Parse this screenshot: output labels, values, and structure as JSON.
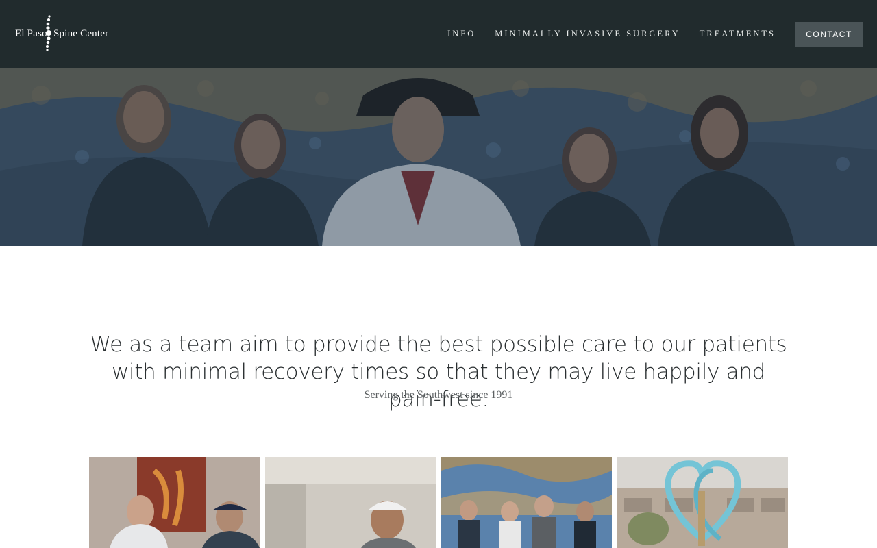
{
  "header": {
    "logo": {
      "left": "El Paso",
      "right": "Spine Center"
    },
    "nav": [
      "INFO",
      "MINIMALLY INVASIVE SURGERY",
      "TREATMENTS"
    ],
    "contact_label": "CONTACT"
  },
  "hero": {
    "image": "team-photo-mosaic-wall"
  },
  "mission": {
    "text": "We as a team aim to provide the best possible care to our patients with minimal recovery times so that they may live happily and pain-free.",
    "tagline": "Serving the Southwest since 1991"
  },
  "gallery": {
    "images": [
      "doctor-with-patient",
      "smiling-patient-cap",
      "group-at-mosaic-wall",
      "heart-sculpture-outdoor"
    ]
  },
  "colors": {
    "header_bg": "#212b2d",
    "contact_bg": "#4a5457",
    "text": "#2a2f31"
  }
}
